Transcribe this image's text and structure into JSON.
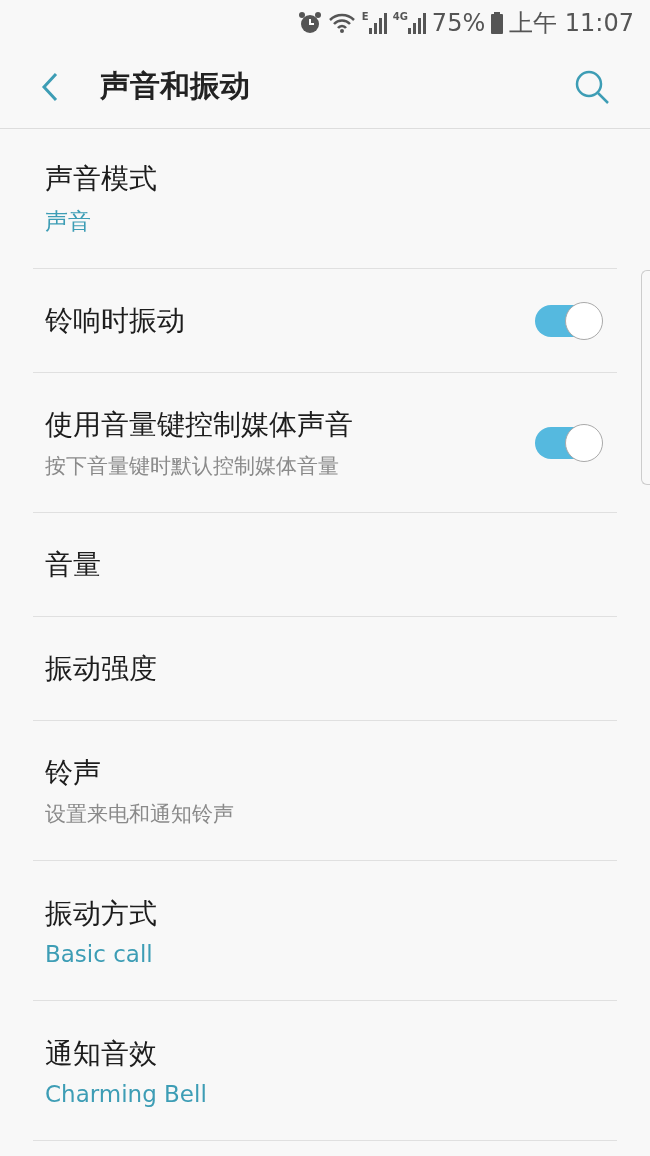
{
  "status_bar": {
    "network_labels": [
      "E",
      "4G"
    ],
    "battery": "75%",
    "time": "上午 11:07"
  },
  "toolbar": {
    "title": "声音和振动"
  },
  "settings": [
    {
      "kind": "link",
      "title": "声音模式",
      "value": "声音"
    },
    {
      "kind": "switch",
      "title": "铃响时振动",
      "on": true
    },
    {
      "kind": "switch",
      "title": "使用音量键控制媒体声音",
      "description": "按下音量键时默认控制媒体音量",
      "on": true
    },
    {
      "kind": "link",
      "title": "音量"
    },
    {
      "kind": "link",
      "title": "振动强度"
    },
    {
      "kind": "link",
      "title": "铃声",
      "description": "设置来电和通知铃声"
    },
    {
      "kind": "link",
      "title": "振动方式",
      "value": "Basic call"
    },
    {
      "kind": "link",
      "title": "通知音效",
      "value": "Charming Bell"
    }
  ]
}
